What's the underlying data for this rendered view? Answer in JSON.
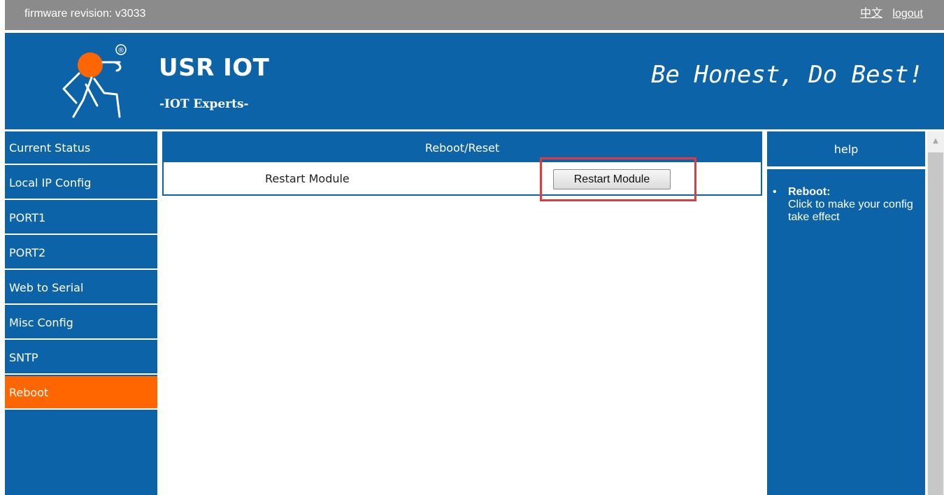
{
  "topbar": {
    "firmware": "firmware revision: v3033",
    "lang_link": "中文",
    "logout_link": "logout"
  },
  "header": {
    "brand": "USR IOT",
    "tagline": "-IOT Experts-",
    "slogan": "Be Honest, Do Best!",
    "registered_mark": "®"
  },
  "sidebar": {
    "items": [
      {
        "label": "Current Status",
        "active": false
      },
      {
        "label": "Local IP Config",
        "active": false
      },
      {
        "label": "PORT1",
        "active": false
      },
      {
        "label": "PORT2",
        "active": false
      },
      {
        "label": "Web to Serial",
        "active": false
      },
      {
        "label": "Misc Config",
        "active": false
      },
      {
        "label": "SNTP",
        "active": false
      },
      {
        "label": "Reboot",
        "active": true
      }
    ]
  },
  "main": {
    "panel_title": "Reboot/Reset",
    "row_label": "Restart Module",
    "button_label": "Restart Module"
  },
  "help": {
    "header": "help",
    "item_title": "Reboot:",
    "item_text": "Click to make your config take effect"
  },
  "colors": {
    "header_blue": "#0d63a8",
    "active_orange": "#ff6600",
    "topbar_gray": "#8b8b8b",
    "highlight_red": "#e03a3e"
  },
  "icons": {
    "logo": "usr-iot-runner-logo-icon",
    "scroll_up": "scroll-up-arrow-icon"
  }
}
